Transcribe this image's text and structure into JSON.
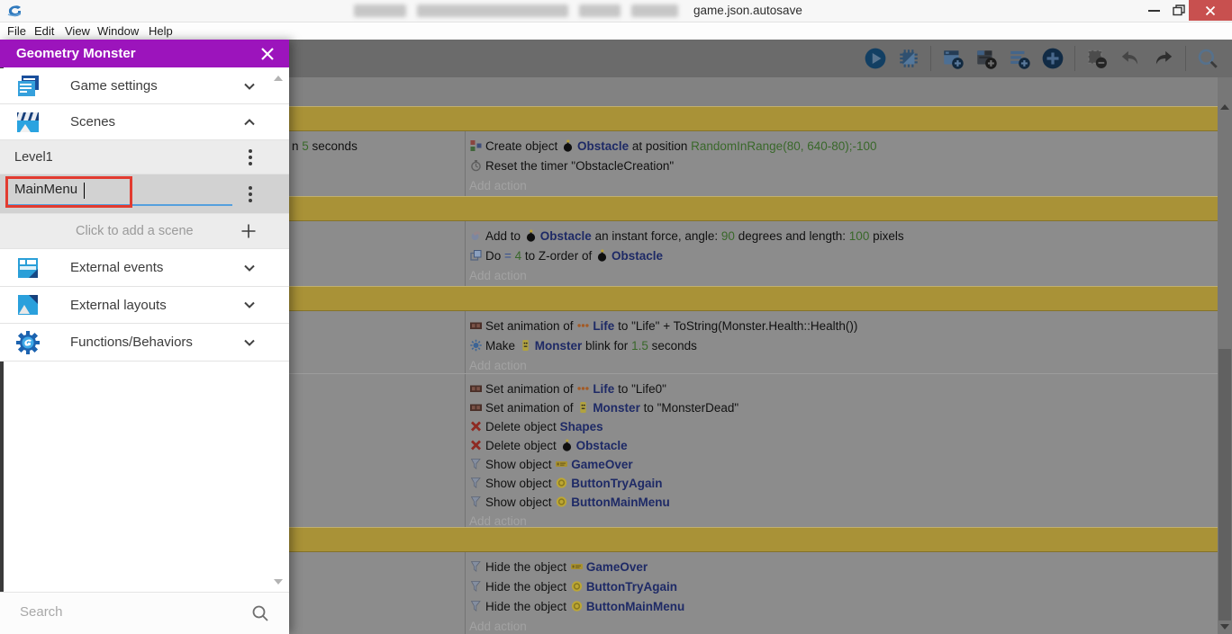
{
  "titlebar": {
    "title": "game.json.autosave"
  },
  "menubar": {
    "items": [
      "File",
      "Edit",
      "View",
      "Window",
      "Help"
    ]
  },
  "toolbar": {
    "groups": [
      [
        "preview-play-icon",
        "debug-icon"
      ],
      [
        "add-event-icon",
        "add-subevent-icon",
        "add-comment-icon",
        "add-more-icon"
      ],
      [
        "delete-event-icon",
        "undo-icon",
        "redo-icon"
      ],
      [
        "search-icon"
      ]
    ]
  },
  "drawer": {
    "title": "Geometry Monster",
    "sections": [
      {
        "label": "Game settings",
        "icon": "game-settings-icon",
        "chevron": "down"
      },
      {
        "label": "Scenes",
        "icon": "scenes-icon",
        "chevron": "up"
      }
    ],
    "scene_items": [
      {
        "name": "Level1"
      },
      {
        "name": "MainMenu",
        "editing": true
      }
    ],
    "add_scene_label": "Click to add a scene",
    "more_sections": [
      {
        "label": "External events",
        "icon": "external-events-icon",
        "chevron": "down"
      },
      {
        "label": "External layouts",
        "icon": "external-layouts-icon",
        "chevron": "down"
      },
      {
        "label": "Functions/Behaviors",
        "icon": "functions-icon",
        "chevron": "down"
      }
    ],
    "search_placeholder": "Search"
  },
  "events": {
    "blocks": [
      {
        "type": "spacer",
        "h": 32
      },
      {
        "type": "group",
        "h": 28
      },
      {
        "type": "event",
        "h": 72,
        "condition": [
          {
            "t": "text",
            "s": "n "
          },
          {
            "t": "num",
            "s": "5"
          },
          {
            "t": "text",
            "s": " seconds"
          }
        ],
        "actions": [
          [
            {
              "t": "icon",
              "n": "create-object-icon"
            },
            {
              "t": "text",
              "s": "Create object "
            },
            {
              "t": "icon",
              "n": "obstacle-icon"
            },
            {
              "t": "obj",
              "s": "Obstacle"
            },
            {
              "t": "text",
              "s": " at position "
            },
            {
              "t": "num",
              "s": "RandomInRange(80, 640-80);-100"
            }
          ],
          [
            {
              "t": "icon",
              "n": "timer-icon"
            },
            {
              "t": "text",
              "s": "Reset the timer \"ObstacleCreation\""
            }
          ],
          [
            {
              "t": "add",
              "s": "Add action"
            }
          ]
        ]
      },
      {
        "type": "group",
        "h": 28
      },
      {
        "type": "event",
        "h": 72,
        "actions": [
          [
            {
              "t": "icon",
              "n": "force-icon"
            },
            {
              "t": "text",
              "s": "Add to "
            },
            {
              "t": "icon",
              "n": "obstacle-icon"
            },
            {
              "t": "obj",
              "s": "Obstacle"
            },
            {
              "t": "text",
              "s": " an instant force, angle: "
            },
            {
              "t": "num",
              "s": "90"
            },
            {
              "t": "text",
              "s": " degrees and length: "
            },
            {
              "t": "num",
              "s": "100"
            },
            {
              "t": "text",
              "s": " pixels"
            }
          ],
          [
            {
              "t": "icon",
              "n": "zorder-icon"
            },
            {
              "t": "text",
              "s": "Do "
            },
            {
              "t": "op",
              "s": "= "
            },
            {
              "t": "num",
              "s": "4"
            },
            {
              "t": "text",
              "s": " to Z-order of "
            },
            {
              "t": "icon",
              "n": "obstacle-icon"
            },
            {
              "t": "obj",
              "s": "Obstacle"
            }
          ],
          [
            {
              "t": "add",
              "s": "Add action"
            }
          ]
        ]
      },
      {
        "type": "group",
        "h": 28
      },
      {
        "type": "event",
        "h": 69,
        "actions": [
          [
            {
              "t": "icon",
              "n": "animation-icon"
            },
            {
              "t": "text",
              "s": "Set animation of "
            },
            {
              "t": "icon",
              "n": "life-icon"
            },
            {
              "t": "obj",
              "s": "Life"
            },
            {
              "t": "text",
              "s": " to \"Life\" + ToString(Monster.Health::Health())"
            }
          ],
          [
            {
              "t": "icon",
              "n": "blink-icon"
            },
            {
              "t": "text",
              "s": "Make "
            },
            {
              "t": "icon",
              "n": "monster-icon"
            },
            {
              "t": "obj",
              "s": "Monster"
            },
            {
              "t": "text",
              "s": " blink for "
            },
            {
              "t": "num",
              "s": "1.5"
            },
            {
              "t": "text",
              "s": " seconds"
            }
          ],
          [
            {
              "t": "add",
              "s": "Add action"
            }
          ]
        ]
      },
      {
        "type": "event",
        "h": 171,
        "dense": true,
        "actions": [
          [
            {
              "t": "icon",
              "n": "animation-icon"
            },
            {
              "t": "text",
              "s": "Set animation of "
            },
            {
              "t": "icon",
              "n": "life-icon"
            },
            {
              "t": "obj",
              "s": "Life"
            },
            {
              "t": "text",
              "s": " to \"Life0\""
            }
          ],
          [
            {
              "t": "icon",
              "n": "animation-icon"
            },
            {
              "t": "text",
              "s": "Set animation of "
            },
            {
              "t": "icon",
              "n": "monster-icon"
            },
            {
              "t": "obj",
              "s": "Monster"
            },
            {
              "t": "text",
              "s": " to \"MonsterDead\""
            }
          ],
          [
            {
              "t": "icon",
              "n": "delete-object-icon"
            },
            {
              "t": "text",
              "s": "Delete object "
            },
            {
              "t": "obj",
              "s": "Shapes"
            }
          ],
          [
            {
              "t": "icon",
              "n": "delete-object-icon"
            },
            {
              "t": "text",
              "s": "Delete object "
            },
            {
              "t": "icon",
              "n": "obstacle-icon"
            },
            {
              "t": "obj",
              "s": "Obstacle"
            }
          ],
          [
            {
              "t": "icon",
              "n": "visibility-icon"
            },
            {
              "t": "text",
              "s": "Show object "
            },
            {
              "t": "icon",
              "n": "gameover-icon"
            },
            {
              "t": "obj",
              "s": "GameOver"
            }
          ],
          [
            {
              "t": "icon",
              "n": "visibility-icon"
            },
            {
              "t": "text",
              "s": "Show object "
            },
            {
              "t": "icon",
              "n": "button-circle-icon"
            },
            {
              "t": "obj",
              "s": "ButtonTryAgain"
            }
          ],
          [
            {
              "t": "icon",
              "n": "visibility-icon"
            },
            {
              "t": "text",
              "s": "Show object "
            },
            {
              "t": "icon",
              "n": "button-circle-icon"
            },
            {
              "t": "obj",
              "s": "ButtonMainMenu"
            }
          ],
          [
            {
              "t": "add",
              "s": "Add action"
            }
          ]
        ]
      },
      {
        "type": "group",
        "h": 28
      },
      {
        "type": "event",
        "h": 94,
        "actions": [
          [
            {
              "t": "icon",
              "n": "visibility-icon"
            },
            {
              "t": "text",
              "s": "Hide the object "
            },
            {
              "t": "icon",
              "n": "gameover-icon"
            },
            {
              "t": "obj",
              "s": "GameOver"
            }
          ],
          [
            {
              "t": "icon",
              "n": "visibility-icon"
            },
            {
              "t": "text",
              "s": "Hide the object "
            },
            {
              "t": "icon",
              "n": "button-circle-icon"
            },
            {
              "t": "obj",
              "s": "ButtonTryAgain"
            }
          ],
          [
            {
              "t": "icon",
              "n": "visibility-icon"
            },
            {
              "t": "text",
              "s": "Hide the object "
            },
            {
              "t": "icon",
              "n": "button-circle-icon"
            },
            {
              "t": "obj",
              "s": "ButtonMainMenu"
            }
          ],
          [
            {
              "t": "add",
              "s": "Add action"
            }
          ]
        ]
      }
    ]
  },
  "colors": {
    "drawer_header": "#9c14bc",
    "annotation_red": "#e23b30",
    "input_underline_blue": "#55a0dd",
    "group_band_gold": "#a99237",
    "object_text_blue": "#1e2a66",
    "expression_green": "#39682a",
    "close_button_red": "#c8504f"
  }
}
